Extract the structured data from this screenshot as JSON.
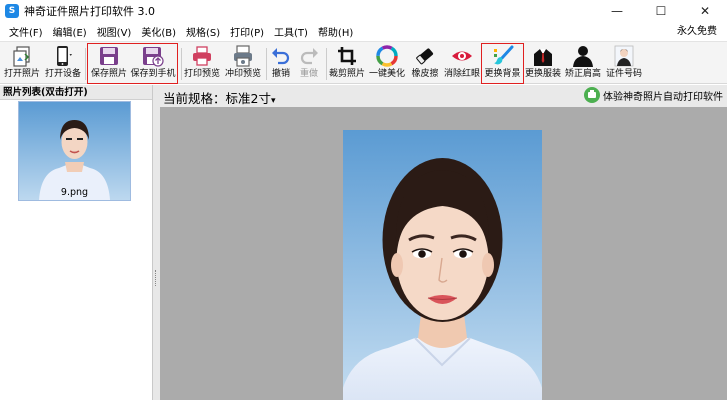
{
  "window": {
    "title": "神奇证件照片打印软件 3.0",
    "app_icon_glyph": "S",
    "minimize": "—",
    "maximize": "☐",
    "close": "✕"
  },
  "menu": {
    "items": [
      "文件(F)",
      "编辑(E)",
      "视图(V)",
      "美化(B)",
      "规格(S)",
      "打印(P)",
      "工具(T)",
      "帮助(H)"
    ],
    "right_label": "永久免费"
  },
  "toolbar": {
    "open_photo": "打开照片",
    "open_device": "打开设备",
    "save_photo": "保存照片",
    "save_to_phone": "保存到手机",
    "print_preview": "打印预览",
    "wash_preview": "冲印预览",
    "undo": "撤销",
    "redo": "重做",
    "crop": "裁剪照片",
    "one_click_beautify": "一键美化",
    "eraser": "橡皮擦",
    "red_eye": "消除红眼",
    "change_background": "更换背景",
    "change_clothes": "更换服装",
    "correct_shoulders": "矫正肩高",
    "id_number": "证件号码"
  },
  "left_panel": {
    "header": "照片列表(双击打开)",
    "thumb_filename": "9.png"
  },
  "main": {
    "spec_label": "当前规格：",
    "spec_value": "标准2寸",
    "dropdown_glyph": "▾",
    "experience_label": "体验神奇照片自动打印软件"
  },
  "colors": {
    "photo_bg_top": "#5b9bd3",
    "photo_bg_bottom": "#bcd8ef",
    "highlight_red": "#e02020",
    "toolbar_purple": "#7a3f8c",
    "accent_green": "#4caf50"
  }
}
